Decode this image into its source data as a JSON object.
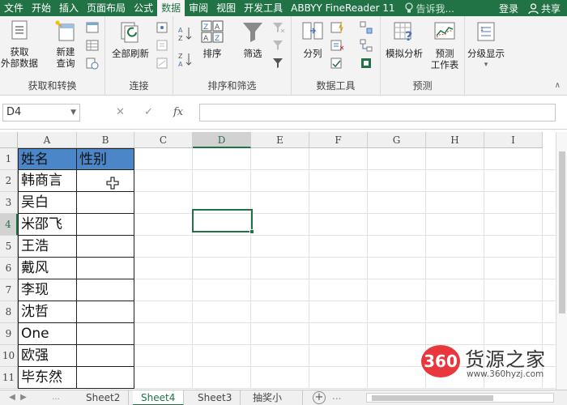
{
  "menu": {
    "tabs": [
      "文件",
      "开始",
      "插入",
      "页面布局",
      "公式",
      "数据",
      "审阅",
      "视图",
      "开发工具",
      "ABBYY FineReader 11"
    ],
    "active_index": 5,
    "tell_me": "告诉我...",
    "login": "登录",
    "share": "共享"
  },
  "ribbon": {
    "get_external": "获取\n外部数据",
    "new_query": "新建\n查询",
    "refresh_all": "全部刷新",
    "sort": "排序",
    "filter": "筛选",
    "text_to_columns": "分列",
    "what_if": "模拟分析",
    "forecast_sheet": "预测\n工作表",
    "outline": "分级显示",
    "groups": {
      "get_transform": "获取和转换",
      "connections": "连接",
      "sort_filter": "排序和筛选",
      "data_tools": "数据工具",
      "forecast": "预测"
    }
  },
  "formula_bar": {
    "name_box": "D4",
    "cancel": "✕",
    "enter": "✓",
    "fx": "fx",
    "value": ""
  },
  "grid": {
    "columns": [
      "A",
      "B",
      "C",
      "D",
      "E",
      "F",
      "G",
      "H",
      "I"
    ],
    "selected_column": "D",
    "rows": [
      "1",
      "2",
      "3",
      "4",
      "5",
      "6",
      "7",
      "8",
      "9",
      "10",
      "11"
    ],
    "selected_row": "4",
    "active_cell": "D4",
    "cells": {
      "A1": "姓名",
      "B1": "性别",
      "A2": "韩商言",
      "A3": "吴白",
      "A4": "米邵飞",
      "A5": "王浩",
      "A6": "戴风",
      "A7": "李现",
      "A8": "沈哲",
      "A9": "One",
      "A10": "欧强",
      "A11": "毕东然"
    },
    "header_fill": "#4a86c8"
  },
  "sheets": {
    "tabs": [
      "Sheet2",
      "Sheet4",
      "Sheet3",
      "抽奖小"
    ],
    "active": "Sheet4",
    "ellipsis": "...",
    "add": "+"
  },
  "watermark": {
    "logo_text": "360",
    "brand": "货源之家",
    "url": "www.360hyzj.com"
  },
  "colors": {
    "accent": "#217346"
  }
}
